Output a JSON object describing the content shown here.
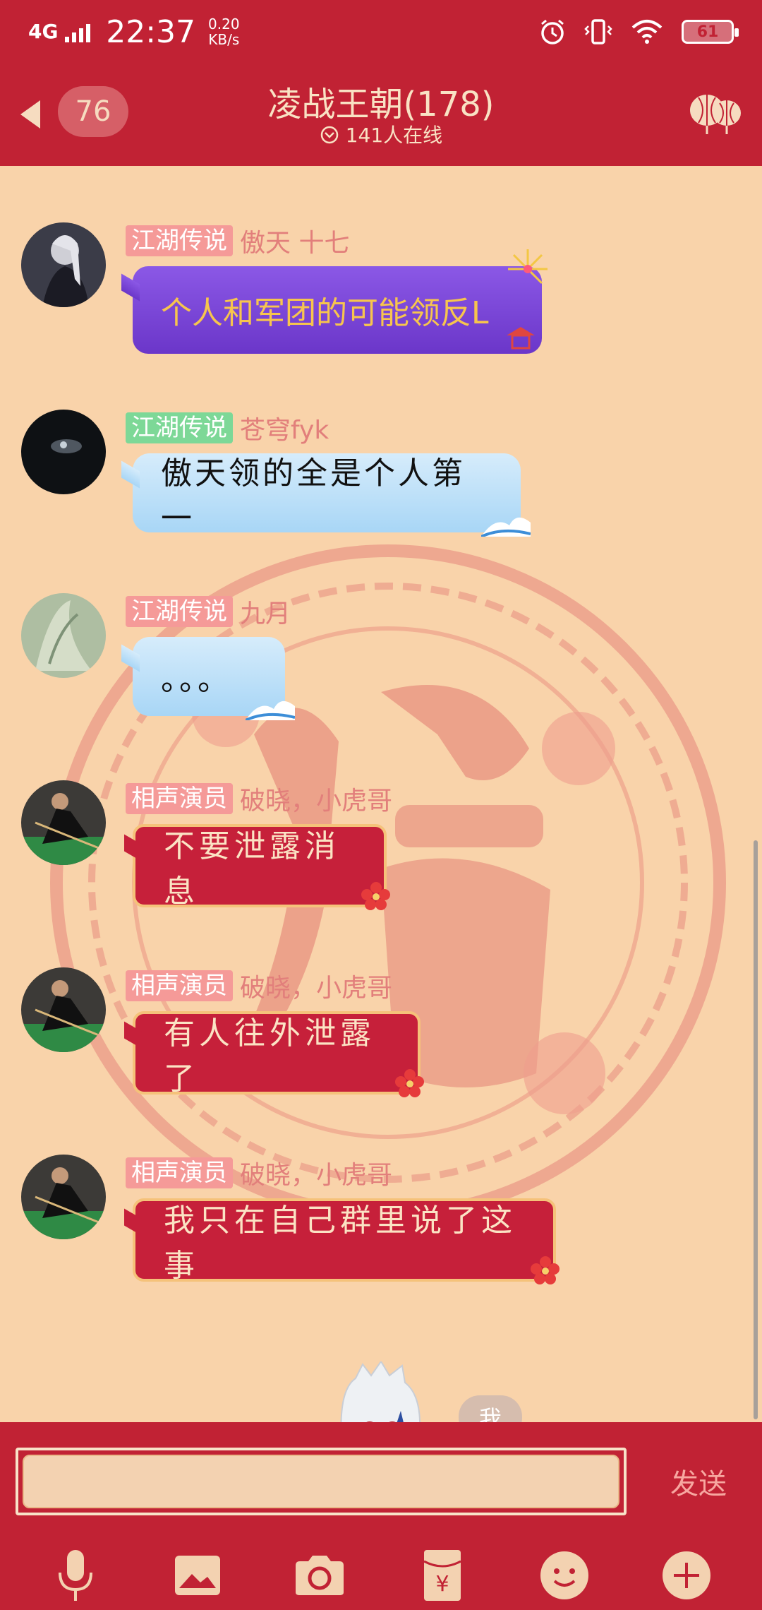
{
  "status_bar": {
    "network": "4G",
    "time": "22:37",
    "speed_value": "0.20",
    "speed_unit": "KB/s",
    "battery": "61"
  },
  "header": {
    "unread_count": "76",
    "title": "凌战王朝(178)",
    "online_text": "141人在线"
  },
  "messages": [
    {
      "tag": "江湖传说",
      "tag_color": "#f59a98",
      "nickname": "傲天   十七",
      "text": "个人和军团的可能领反L",
      "style": "purple"
    },
    {
      "tag": "江湖传说",
      "tag_color": "#7dd897",
      "nickname": "苍穹fyk",
      "text": "傲天领的全是个人第一",
      "style": "blue"
    },
    {
      "tag": "江湖传说",
      "tag_color": "#f59a98",
      "nickname": "九月",
      "text": "。。。",
      "style": "blue"
    },
    {
      "tag": "相声演员",
      "tag_color": "#f59a98",
      "nickname": "破晓，小虎哥",
      "text": "不要泄露消息",
      "style": "red"
    },
    {
      "tag": "相声演员",
      "tag_color": "#f59a98",
      "nickname": "破晓，小虎哥",
      "text": "有人往外泄露了",
      "style": "red"
    },
    {
      "tag": "相声演员",
      "tag_color": "#f59a98",
      "nickname": "破晓，小虎哥",
      "text": "我只在自己群里说了这事",
      "style": "red"
    }
  ],
  "self": {
    "badge": "我"
  },
  "input": {
    "value": "",
    "send_label": "发送"
  },
  "toolbar": {
    "icons": [
      "microphone-icon",
      "image-icon",
      "camera-icon",
      "red-packet-icon",
      "emoji-icon",
      "plus-icon"
    ]
  },
  "colors": {
    "primary": "#c12234",
    "background": "#f9d3aa",
    "accent_gold": "#f5c27a"
  }
}
